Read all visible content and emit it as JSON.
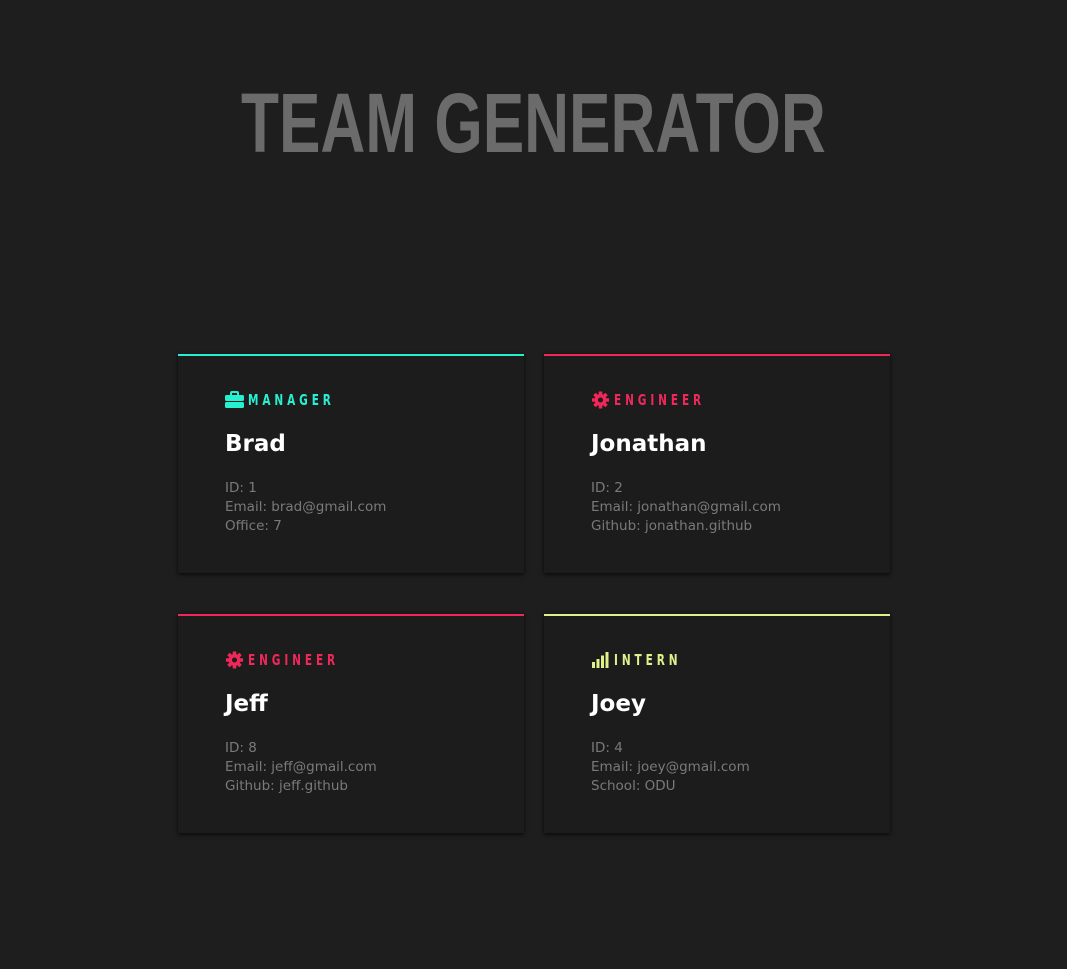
{
  "title": "TEAM GENERATOR",
  "colors": {
    "background": "#1e1e1e",
    "card": "#1c1c1c",
    "title": "#6b6b6b",
    "manager": "#27f0d0",
    "engineer": "#f0285a",
    "intern": "#e0f08a",
    "name": "#ffffff",
    "detail": "#7a7a7a"
  },
  "cards": [
    {
      "role": "MANAGER",
      "role_icon": "briefcase-icon",
      "name": "Brad",
      "id": "ID: 1",
      "email": "Email: brad@gmail.com",
      "extra": "Office: 7"
    },
    {
      "role": "ENGINEER",
      "role_icon": "gear-icon",
      "name": "Jonathan",
      "id": "ID: 2",
      "email": "Email: jonathan@gmail.com",
      "extra": "Github: jonathan.github"
    },
    {
      "role": "ENGINEER",
      "role_icon": "gear-icon",
      "name": "Jeff",
      "id": "ID: 8",
      "email": "Email: jeff@gmail.com",
      "extra": "Github: jeff.github"
    },
    {
      "role": "INTERN",
      "role_icon": "signal-bars-icon",
      "name": "Joey",
      "id": "ID: 4",
      "email": "Email: joey@gmail.com",
      "extra": "School: ODU"
    }
  ]
}
